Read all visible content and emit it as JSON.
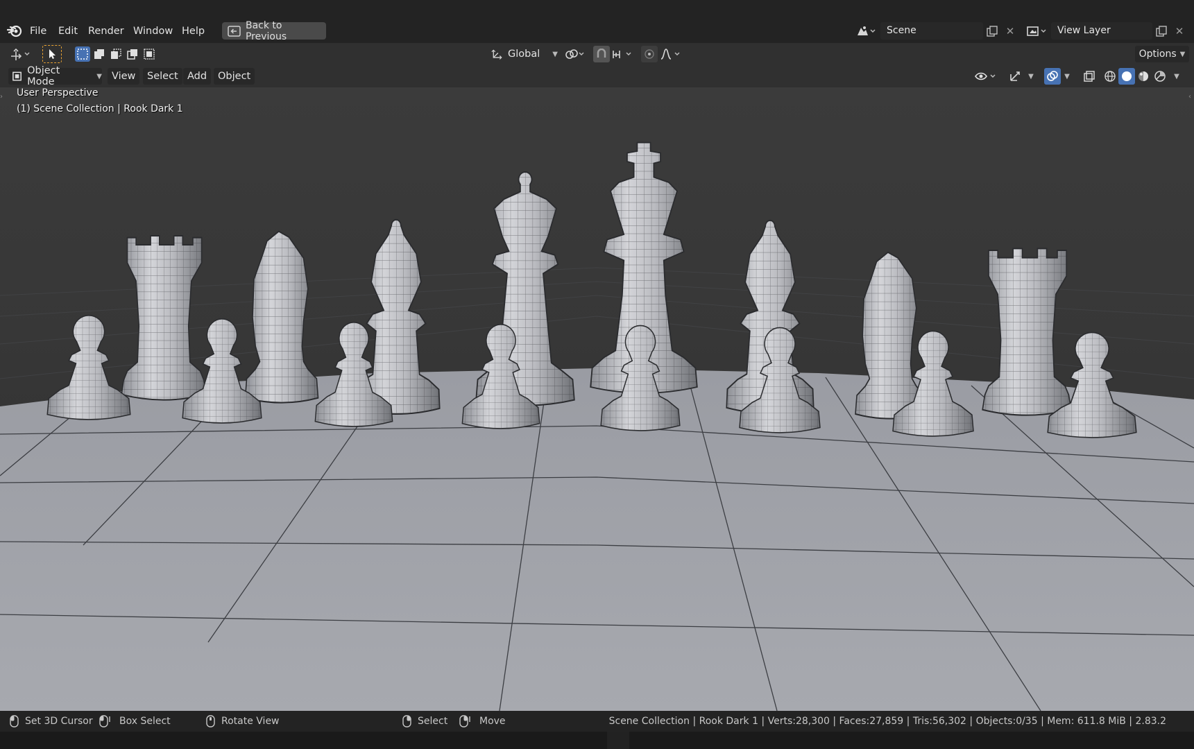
{
  "menubar": {
    "items": [
      "File",
      "Edit",
      "Render",
      "Window",
      "Help"
    ],
    "back_button": "Back to Previous",
    "scene": "Scene",
    "view_layer": "View Layer"
  },
  "toolheader": {
    "transform_orientation": "Global",
    "options_label": "Options"
  },
  "viewport_header": {
    "mode": "Object Mode",
    "menus": [
      "View",
      "Select",
      "Add",
      "Object"
    ]
  },
  "viewport": {
    "view_name": "User Perspective",
    "collection_info": "(1) Scene Collection | Rook Dark 1"
  },
  "statusbar": {
    "items": [
      "Set 3D Cursor",
      "Box Select",
      "Rotate View",
      "Select",
      "Move"
    ],
    "stats": "Scene Collection | Rook Dark 1 | Verts:28,300 | Faces:27,859 | Tris:56,302 | Objects:0/35 | Mem: 611.8 MiB | 2.83.2"
  },
  "colors": {
    "header_bg": "#303030",
    "menubar_bg": "#232323",
    "active_blue": "#4772b3",
    "selected_orange": "#e8a232"
  },
  "icons": [
    "blender-logo-icon",
    "back-arrow-icon",
    "scene-icon",
    "view-layer-icon",
    "select-tool-icon",
    "box-select-mode-icons",
    "orientation-icon",
    "pivot-icon",
    "snap-icon",
    "proportional-edit-icon",
    "visibility-icon",
    "gizmo-icon",
    "overlay-icon",
    "xray-icon",
    "shading-icons",
    "mouse-icon"
  ]
}
